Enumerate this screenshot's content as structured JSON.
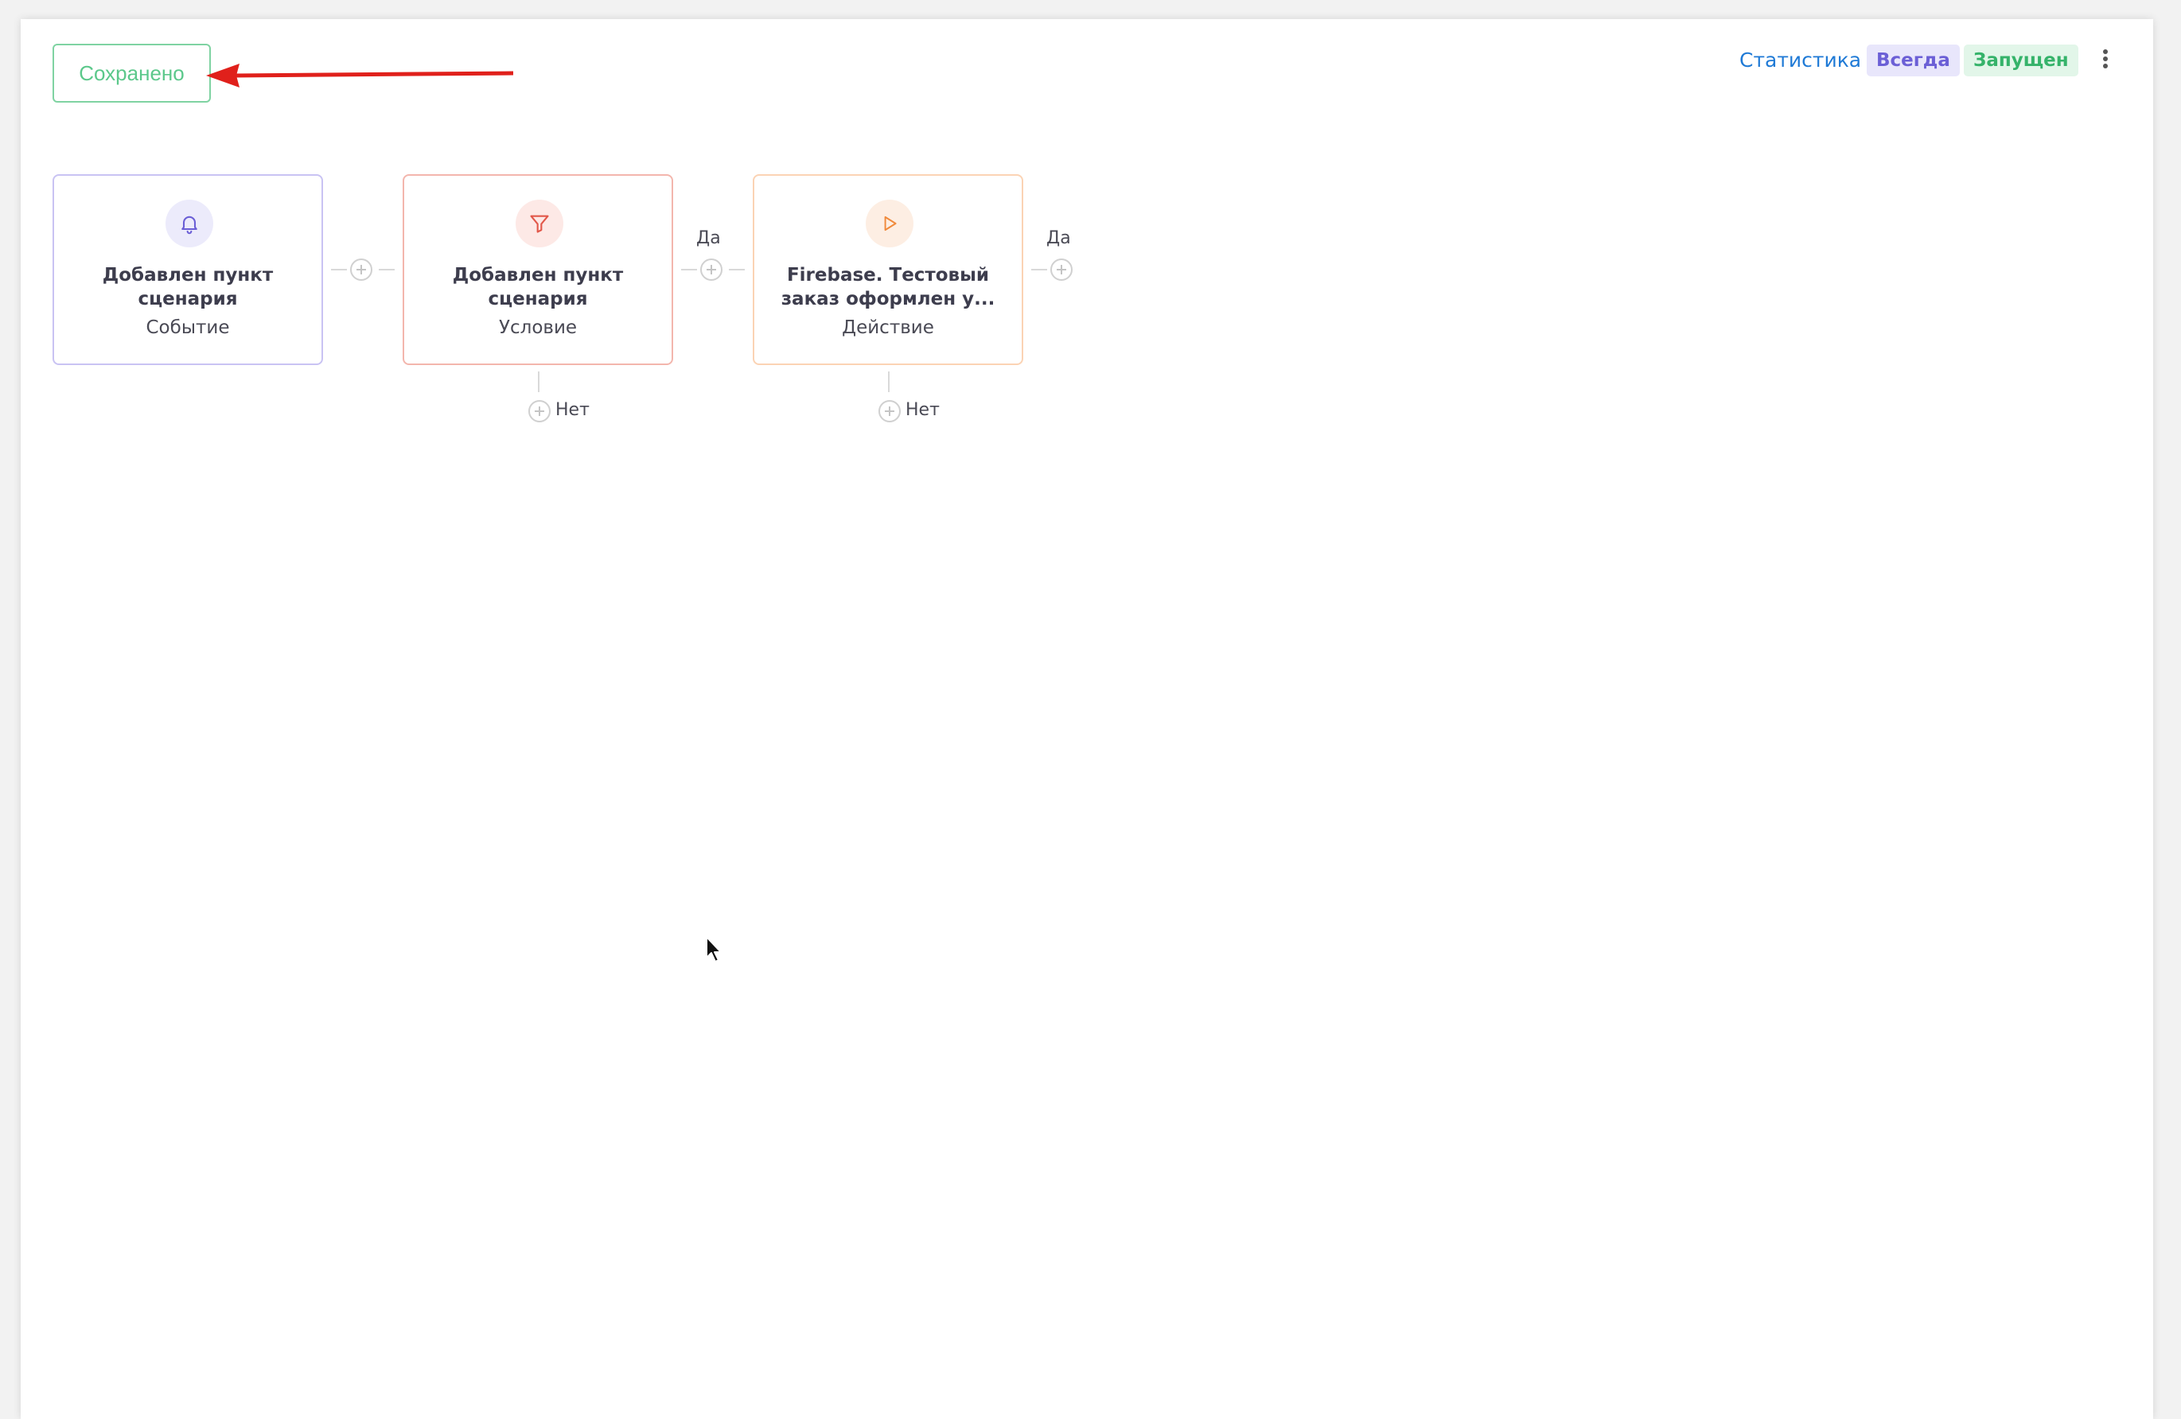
{
  "header": {
    "save_status": "Сохранено",
    "stats_link": "Статистика",
    "frequency_badge": "Всегда",
    "status_badge": "Запущен"
  },
  "colors": {
    "saved_green": "#5cc88b",
    "link_blue": "#1f7ad6",
    "event_purple": "#6b5fd6",
    "condition_red": "#e2584a",
    "action_orange": "#f08a3c",
    "annotation_red": "#e0201b"
  },
  "flow": {
    "nodes": [
      {
        "title": "Добавлен пункт сценария",
        "type": "Событие",
        "icon": "bell-icon"
      },
      {
        "title": "Добавлен пункт сценария",
        "type": "Условие",
        "icon": "filter-icon"
      },
      {
        "title": "Firebase. Тестовый заказ оформлен у...",
        "type": "Действие",
        "icon": "play-icon"
      }
    ],
    "yes_label": "Да",
    "no_label": "Нет"
  }
}
